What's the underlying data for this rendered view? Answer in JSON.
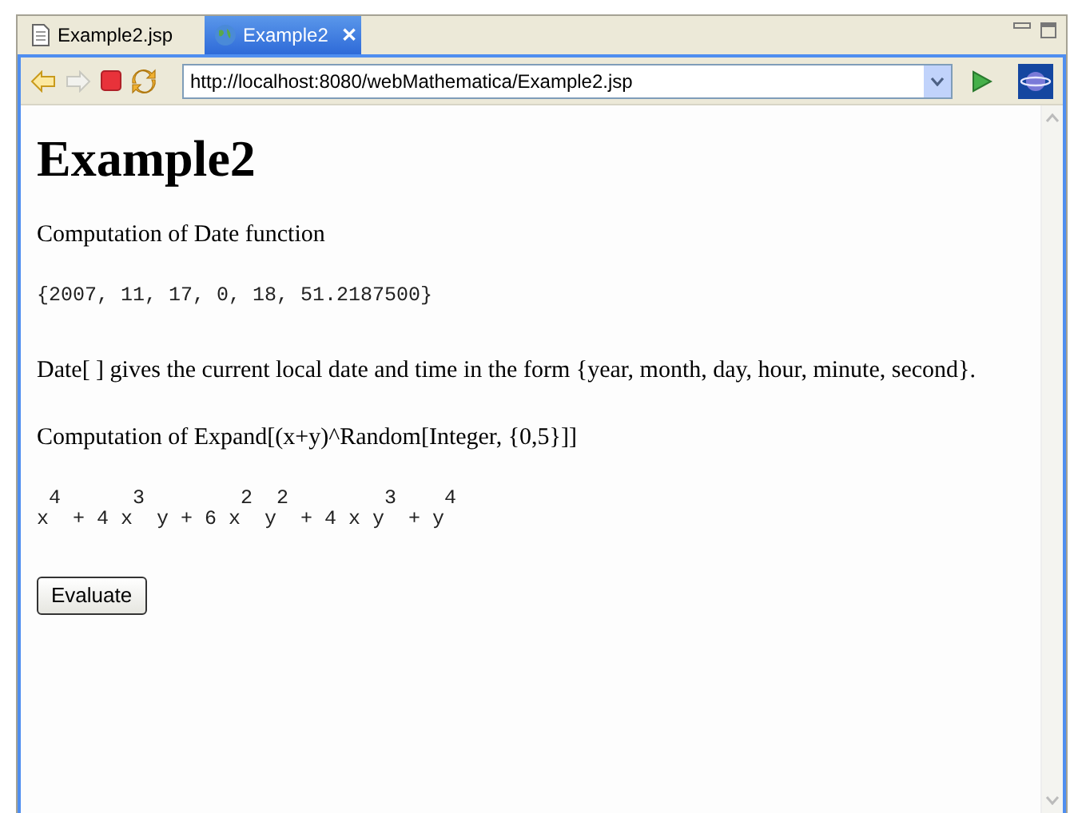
{
  "tabs": [
    {
      "label": "Example2.jsp",
      "kind": "file",
      "selected": false
    },
    {
      "label": "Example2",
      "kind": "web",
      "selected": true,
      "close": "✕"
    }
  ],
  "address": {
    "value": "http://localhost:8080/webMathematica/Example2.jsp"
  },
  "page": {
    "heading": "Example2",
    "blocks": [
      {
        "kind": "para",
        "text": "Computation of Date function"
      },
      {
        "kind": "mono",
        "lines": [
          "{2007, 11, 17, 0, 18, 51.2187500}"
        ]
      },
      {
        "kind": "para",
        "text": "Date[ ] gives the current local date and time in the form {year, month, day, hour, minute, second}."
      },
      {
        "kind": "para",
        "text": "Computation of Expand[(x+y)^Random[Integer, {0,5}]]"
      },
      {
        "kind": "mono",
        "lines": [
          " 4      3        2  2        3    4",
          "x  + 4 x  y + 6 x  y  + 4 x y  + y"
        ]
      },
      {
        "kind": "button",
        "text": "Evaluate"
      }
    ]
  }
}
